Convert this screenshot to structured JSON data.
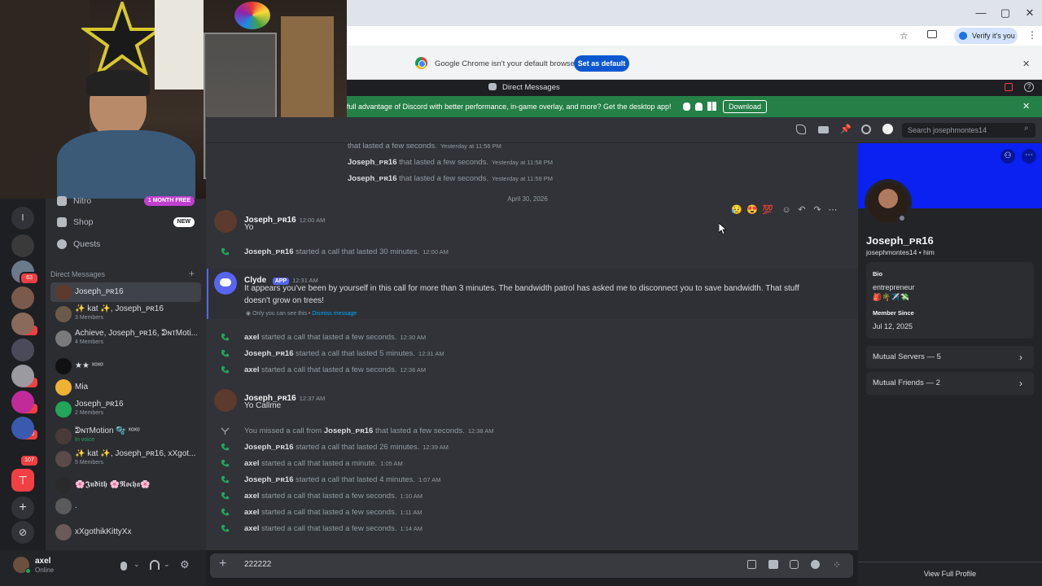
{
  "browser": {
    "verify_label": "Verify it's you",
    "default_message": "Google Chrome isn't your default browser",
    "default_button": "Set as default"
  },
  "discord": {
    "window_title": "Direct Messages",
    "banner_text": "full advantage of Discord with better performance, in-game overlay, and more? Get the desktop app!",
    "banner_button": "Download",
    "search_placeholder": "Search josephmontes14"
  },
  "sidebar": {
    "nitro": "Nitro",
    "nitro_badge": "1 MONTH FREE",
    "shop": "Shop",
    "shop_badge": "NEW",
    "quests": "Quests",
    "dm_header": "Direct Messages",
    "dms": [
      {
        "name": "Joseph_ᴘʀ16",
        "sub": "",
        "color": "#5c3a2e"
      },
      {
        "name": "✨ kat ✨, Joseph_ᴘʀ16",
        "sub": "3 Members",
        "color": "#6b5a4a"
      },
      {
        "name": "Achieve, Joseph_ᴘʀ16, ᕲɴᴛMoti...",
        "sub": "4 Members",
        "color": "#7a7a7a"
      },
      {
        "name": "★★ ˣᵒˣᵒ",
        "sub": "",
        "color": "#111111"
      },
      {
        "name": "Mia",
        "sub": "",
        "color": "#f0b232"
      },
      {
        "name": "Joseph_ᴘʀ16",
        "sub": "2 Members",
        "color": "#23a55a"
      },
      {
        "name": "ᕲɴᴛMotion 🫧 ˣᵒˣᵒ",
        "sub": "In voice",
        "color": "#4a3a3a"
      },
      {
        "name": "✨ kat ✨, Joseph_ᴘʀ16, xXgot...",
        "sub": "5 Members",
        "color": "#5a4a4a"
      },
      {
        "name": "🌸𝕵𝖚𝖉𝖎𝖙𝖍 🌸𝕽𝖔𝖈𝖍𝖆🌸",
        "sub": "",
        "color": "#2a2a2a"
      },
      {
        "name": ".",
        "sub": "",
        "color": "#5a5a5a"
      },
      {
        "name": "xXgothikKittyXx",
        "sub": "",
        "color": "#6a5a5a"
      }
    ],
    "badges": [
      "63",
      "2",
      "40",
      "99",
      "140",
      "107"
    ]
  },
  "user": {
    "name": "axel",
    "status": "Online"
  },
  "chat": {
    "top_lines": [
      {
        "text": "that lasted a few seconds.",
        "time": "Yesterday at 11:56 PM",
        "who": ""
      },
      {
        "text": "that lasted a few seconds.",
        "time": "Yesterday at 11:58 PM",
        "who": "Joseph_ᴘʀ16"
      },
      {
        "text": "that lasted a few seconds.",
        "time": "Yesterday at 11:59 PM",
        "who": "Joseph_ᴘʀ16"
      }
    ],
    "date_divider": "April 30, 2026",
    "msg1_author": "Joseph_ᴘʀ16",
    "msg1_time": "12:00 AM",
    "msg1_text": "Yo",
    "call1": {
      "who": "Joseph_ᴘʀ16",
      "text": "started a call that lasted 30 minutes.",
      "time": "12:00 AM"
    },
    "clyde_author": "Clyde",
    "clyde_tag": "APP",
    "clyde_time": "12:31 AM",
    "clyde_text": "It appears you've been by yourself in this call for more than 3 minutes. The bandwidth patrol has asked me to disconnect you to save bandwidth. That stuff doesn't grow on trees!",
    "clyde_note": "Only you can see this •",
    "clyde_dismiss": "Dismiss message",
    "calls_a": [
      {
        "who": "axel",
        "text": "started a call that lasted a few seconds.",
        "time": "12:30 AM"
      },
      {
        "who": "Joseph_ᴘʀ16",
        "text": "started a call that lasted 5 minutes.",
        "time": "12:31 AM"
      },
      {
        "who": "axel",
        "text": "started a call that lasted a few seconds.",
        "time": "12:36 AM"
      }
    ],
    "msg2_author": "Joseph_ᴘʀ16",
    "msg2_time": "12:37 AM",
    "msg2_text": "Yo Callme",
    "missed_prefix": "You missed a call from",
    "missed_who": "Joseph_ᴘʀ16",
    "missed_suffix": "that lasted a few seconds.",
    "missed_time": "12:38 AM",
    "calls_b": [
      {
        "who": "Joseph_ᴘʀ16",
        "text": "started a call that lasted 26 minutes.",
        "time": "12:39 AM"
      },
      {
        "who": "axel",
        "text": "started a call that lasted a minute.",
        "time": "1:05 AM"
      },
      {
        "who": "Joseph_ᴘʀ16",
        "text": "started a call that lasted 4 minutes.",
        "time": "1:07 AM"
      },
      {
        "who": "axel",
        "text": "started a call that lasted a few seconds.",
        "time": "1:10 AM"
      },
      {
        "who": "axel",
        "text": "started a call that lasted a few seconds.",
        "time": "1:11 AM"
      },
      {
        "who": "axel",
        "text": "started a call that lasted a few seconds.",
        "time": "1:14 AM"
      }
    ],
    "composer_value": "222222"
  },
  "profile": {
    "display_name": "Joseph_ᴘʀ16",
    "username": "josephmontes14",
    "pronouns": "him",
    "bio_label": "Bio",
    "bio_text": "entrepreneur",
    "bio_emojis": "🎒🌴✈️💸",
    "member_since_label": "Member Since",
    "member_since": "Jul 12, 2025",
    "mutual_servers": "Mutual Servers — 5",
    "mutual_friends": "Mutual Friends — 2",
    "view_full": "View Full Profile",
    "banner_color": "#0a21f2"
  }
}
